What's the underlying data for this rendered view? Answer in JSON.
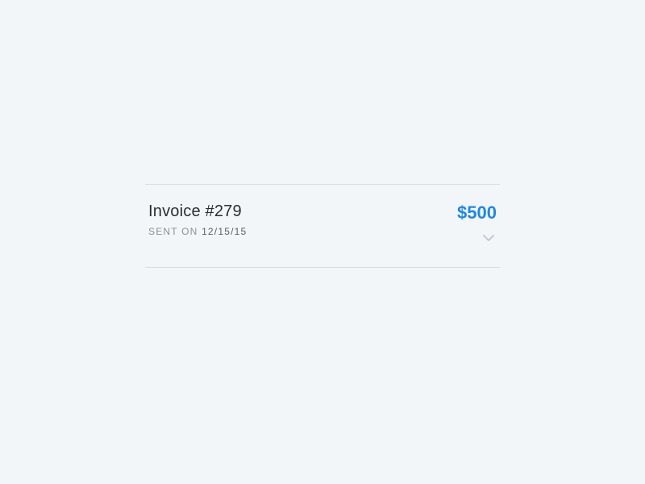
{
  "invoice": {
    "title": "Invoice #279",
    "sent_label": "SENT ON ",
    "sent_date": "12/15/15",
    "amount": "$500"
  }
}
